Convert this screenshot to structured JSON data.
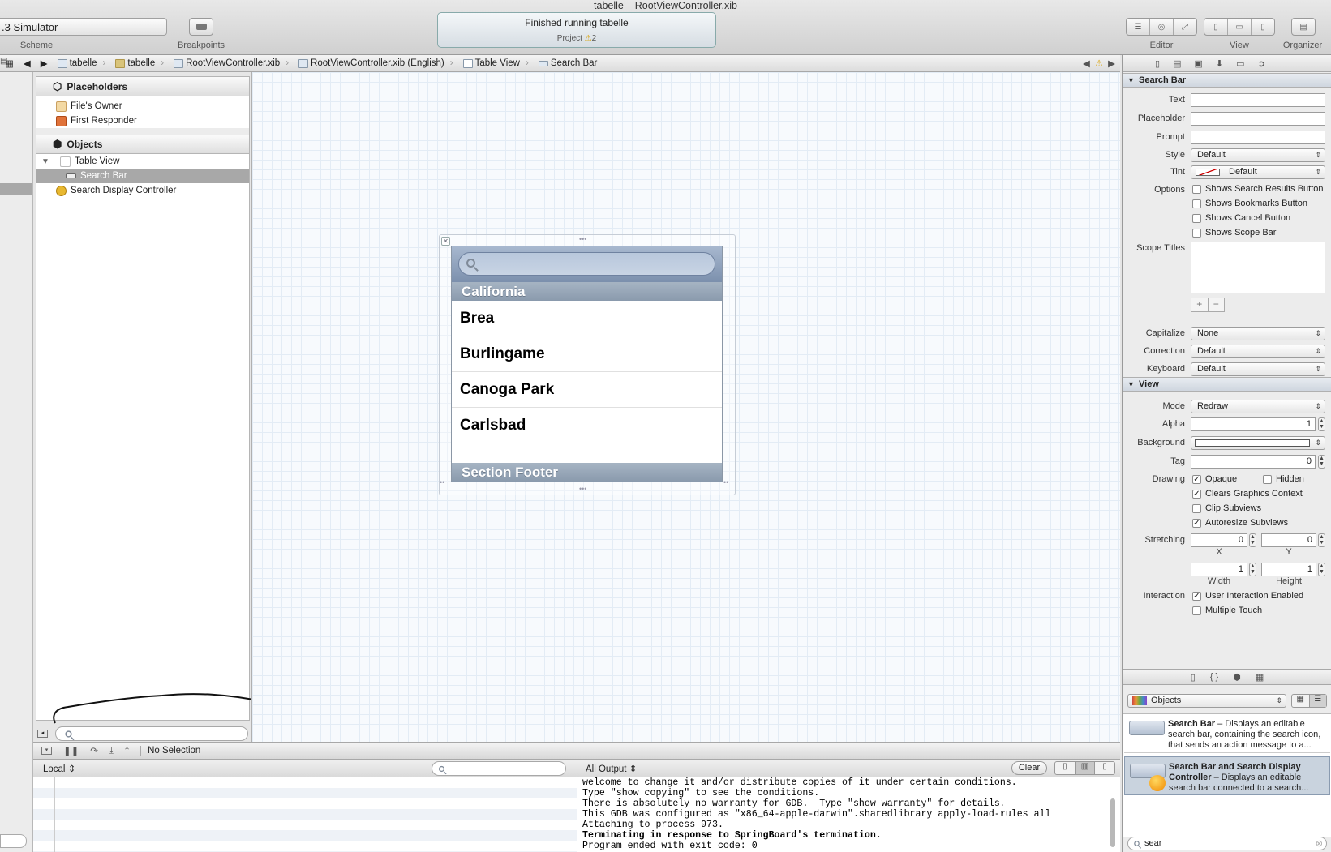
{
  "window": {
    "title": "tabelle – RootViewController.xib"
  },
  "toolbar": {
    "scheme_value": ".3 Simulator",
    "scheme_label": "Scheme",
    "breakpoints_label": "Breakpoints",
    "activity_title": "Finished running tabelle",
    "activity_project": "Project",
    "activity_warnings": "2",
    "editor_label": "Editor",
    "view_label": "View",
    "organizer_label": "Organizer"
  },
  "jumpbar": {
    "items": [
      "tabelle",
      "tabelle",
      "RootViewController.xib",
      "RootViewController.xib (English)",
      "Table View",
      "Search Bar"
    ]
  },
  "outline": {
    "placeholders_title": "Placeholders",
    "placeholders": [
      "File's Owner",
      "First Responder"
    ],
    "objects_title": "Objects",
    "table_view": "Table View",
    "search_bar": "Search Bar",
    "search_display_controller": "Search Display Controller"
  },
  "canvas": {
    "section_header": "California",
    "cells": [
      "Brea",
      "Burlingame",
      "Canoga Park",
      "Carlsbad"
    ],
    "section_footer": "Section Footer"
  },
  "inspector": {
    "search_bar_title": "Search Bar",
    "text_label": "Text",
    "placeholder_label": "Placeholder",
    "prompt_label": "Prompt",
    "style_label": "Style",
    "style_value": "Default",
    "tint_label": "Tint",
    "tint_value": "Default",
    "options_label": "Options",
    "options": [
      "Shows Search Results Button",
      "Shows Bookmarks Button",
      "Shows Cancel Button",
      "Shows Scope Bar"
    ],
    "scope_titles_label": "Scope Titles",
    "add_symbol": "+",
    "remove_symbol": "−",
    "capitalize_label": "Capitalize",
    "capitalize_value": "None",
    "correction_label": "Correction",
    "correction_value": "Default",
    "keyboard_label": "Keyboard",
    "keyboard_value": "Default",
    "view_title": "View",
    "mode_label": "Mode",
    "mode_value": "Redraw",
    "alpha_label": "Alpha",
    "alpha_value": "1",
    "background_label": "Background",
    "tag_label": "Tag",
    "tag_value": "0",
    "drawing_label": "Drawing",
    "opaque": "Opaque",
    "hidden": "Hidden",
    "clears_graphics": "Clears Graphics Context",
    "clip_subviews": "Clip Subviews",
    "autoresize_subviews": "Autoresize Subviews",
    "stretching_label": "Stretching",
    "stretch_x": "0",
    "stretch_y": "0",
    "x_label": "X",
    "y_label": "Y",
    "stretch_width": "1",
    "stretch_height": "1",
    "width_label": "Width",
    "height_label": "Height",
    "interaction_label": "Interaction",
    "user_interaction": "User Interaction Enabled",
    "multiple_touch": "Multiple Touch"
  },
  "library": {
    "selector_value": "Objects",
    "items": [
      {
        "name": "Search Bar",
        "desc": " – Displays an editable search bar, containing the search icon, that sends an action message to a..."
      },
      {
        "name": "Search Bar and Search Display Controller",
        "desc": " – Displays an editable search bar connected to a search..."
      }
    ],
    "filter_value": "sear"
  },
  "debug": {
    "no_selection": "No Selection",
    "scope_value": "Local",
    "output_value": "All Output",
    "clear_label": "Clear",
    "console_lines": [
      "welcome to change it and/or distribute copies of it under certain conditions.",
      "Type \"show copying\" to see the conditions.",
      "There is absolutely no warranty for GDB.  Type \"show warranty\" for details.",
      "This GDB was configured as \"x86_64-apple-darwin\".sharedlibrary apply-load-rules all",
      "Attaching to process 973."
    ],
    "console_bold": "Terminating in response to SpringBoard's termination.",
    "console_last": "Program ended with exit code: 0"
  }
}
